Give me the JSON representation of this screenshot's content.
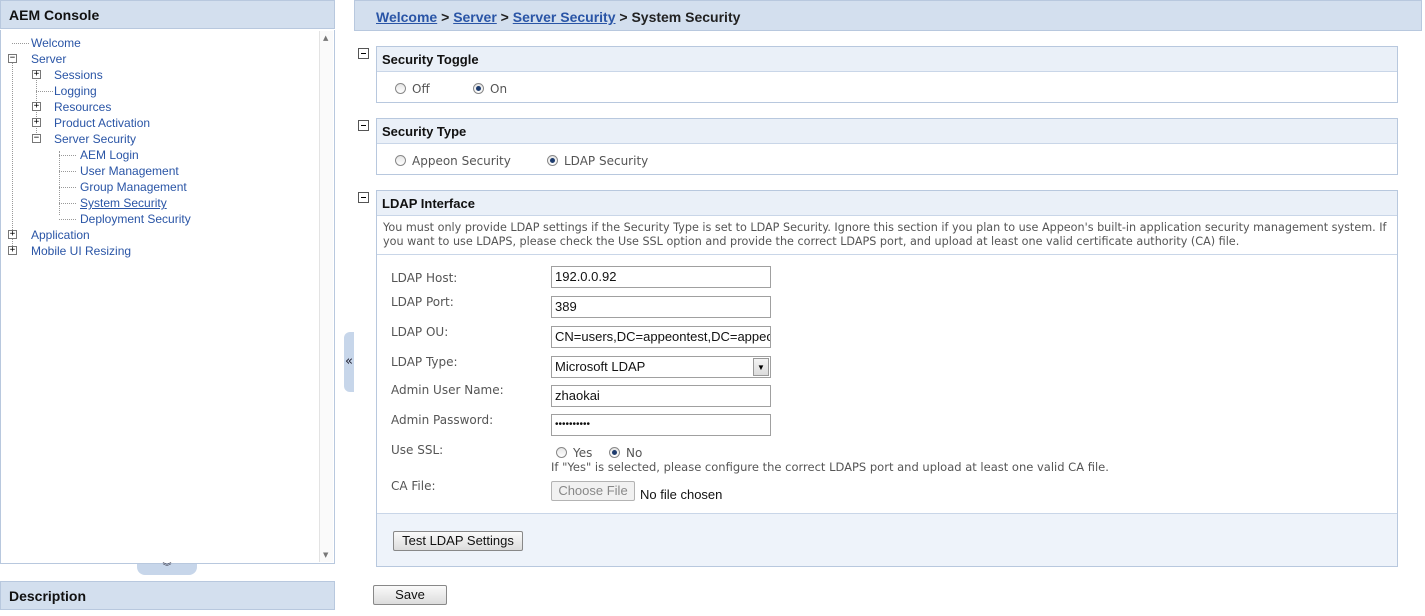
{
  "left_panel": {
    "title": "AEM Console",
    "description_title": "Description",
    "tree": [
      {
        "label": "Welcome"
      },
      {
        "label": "Server"
      },
      {
        "label": "Sessions"
      },
      {
        "label": "Logging"
      },
      {
        "label": "Resources"
      },
      {
        "label": "Product Activation"
      },
      {
        "label": "Server Security"
      },
      {
        "label": "AEM Login"
      },
      {
        "label": "User Management"
      },
      {
        "label": "Group Management"
      },
      {
        "label": "System Security"
      },
      {
        "label": "Deployment Security"
      },
      {
        "label": "Application"
      },
      {
        "label": "Mobile UI Resizing"
      }
    ]
  },
  "breadcrumb": {
    "items": [
      "Welcome",
      "Server",
      "Server Security"
    ],
    "separator": ">",
    "current": "System Security"
  },
  "security_toggle": {
    "title": "Security Toggle",
    "options": [
      "Off",
      "On"
    ],
    "selected": "On"
  },
  "security_type": {
    "title": "Security Type",
    "options": [
      "Appeon Security",
      "LDAP Security"
    ],
    "selected": "LDAP Security"
  },
  "ldap": {
    "title": "LDAP Interface",
    "description": "You must only provide LDAP settings if the Security Type is set to LDAP Security.  Ignore this section if you plan to use Appeon's built-in application security management system. If you want to use LDAPS, please check the Use SSL option and provide the correct LDAPS port, and upload at least one valid certificate authority (CA) file.",
    "host_label": "LDAP Host:",
    "host_value": "192.0.0.92",
    "port_label": "LDAP Port:",
    "port_value": "389",
    "ou_label": "LDAP OU:",
    "ou_value": "CN=users,DC=appeontest,DC=appeon",
    "type_label": "LDAP Type:",
    "type_value": "Microsoft LDAP",
    "admin_user_label": "Admin User Name:",
    "admin_user_value": "zhaokai",
    "admin_pw_label": "Admin Password:",
    "admin_pw_value": "••••••••••",
    "ssl_label": "Use SSL:",
    "ssl_options": [
      "Yes",
      "No"
    ],
    "ssl_selected": "No",
    "ssl_note": "If \"Yes\" is selected, please configure the correct LDAPS port and upload at least one valid CA file.",
    "ca_label": "CA File:",
    "ca_button": "Choose File",
    "ca_status": "No file chosen",
    "test_button": "Test LDAP Settings"
  },
  "save_button": "Save",
  "colors": {
    "header_bg": "#d3dfee",
    "link": "#2a55a6",
    "border": "#b8c8de"
  }
}
